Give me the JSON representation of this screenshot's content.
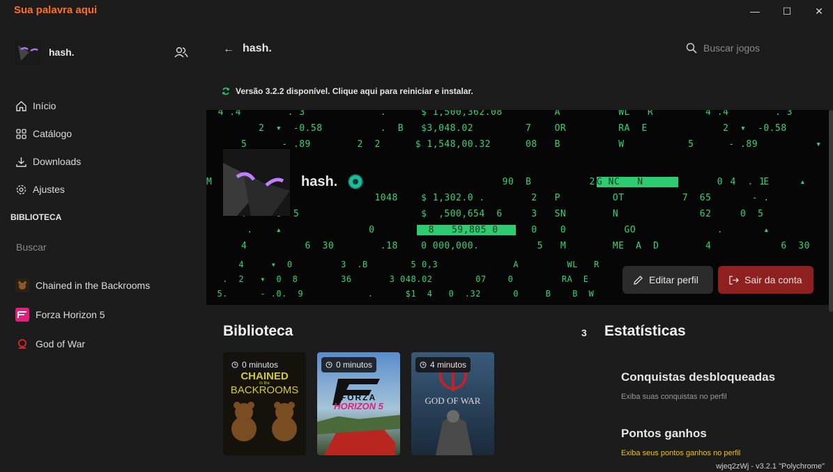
{
  "app": {
    "title": "Sua palavra aqui"
  },
  "window_controls": {
    "minimize": "—",
    "maximize": "☐",
    "close": "✕"
  },
  "sidebar": {
    "profile_name": "hash.",
    "nav": [
      {
        "label": "Início",
        "icon": "home-icon"
      },
      {
        "label": "Catálogo",
        "icon": "grid-icon"
      },
      {
        "label": "Downloads",
        "icon": "download-icon"
      },
      {
        "label": "Ajustes",
        "icon": "gear-icon"
      }
    ],
    "library_heading": "BIBLIOTECA",
    "library_search_placeholder": "Buscar",
    "games": [
      {
        "name": "Chained in the Backrooms",
        "icon": "chained-game-icon"
      },
      {
        "name": "Forza Horizon 5",
        "icon": "forza-game-icon"
      },
      {
        "name": "God of War",
        "icon": "gow-game-icon"
      }
    ]
  },
  "header": {
    "back": "←",
    "title": "hash.",
    "search_placeholder": "Buscar jogos"
  },
  "update_notice": "Versão 3.2.2 disponível. Clique aqui para reiniciar e instalar.",
  "profile_banner": {
    "name": "hash.",
    "matrix_rows": [
      "  4 .4        . 3             .      $ 1,500,362.08         A          WL   R         4 .4        . 3             ",
      "         2  ▾  -0.58          .  B   $3,048.02         7    OR         RA  E             2  ▾  -0.58          .  ",
      "      5      - .89        2  2      $ 1,548,00.32      08   B          W           5      - .89          ▾   ",
      "M                                                                                                         ",
      "     - .                     1048    $ 1,302.0 .        2   P         OT          7  65       - .          ",
      "      .     0  5                     $  ,500,654  6     3   SN        N              62     0  5          ",
      "       .    ▴               0                           0    0          GO              .       ▴          ",
      "      4          6  30        .18    0 000,000.          5   M        ME  A  D        4            6  30    ",
      "      4     ▾  0         3  .B        5 0,3              A         WL   R                                   ",
      "   .  2   ▾  0  8        36       3 048.02        07    0         RA  E                                    ",
      "  5.      - .0.  9            .      $1  4   0  .32      0     B    B  W                                   "
    ],
    "highlight_1": "G NC   N      ",
    "highlight_2": "  8   59,805 0   ",
    "row3_mid": "                                                   90  B          2 0     5    2        0       E ",
    "row3_tail": "         4  . 1      ▴      7 0       ▾"
  },
  "buttons": {
    "edit_profile": "Editar perfil",
    "logout": "Sair da conta"
  },
  "library": {
    "title": "Biblioteca",
    "count": "3",
    "cards": [
      {
        "time": "0 minutos",
        "game": "Chained in the Backrooms",
        "cover_line1": "CHAINED",
        "cover_line2": "in the",
        "cover_line3": "BACKROOMS"
      },
      {
        "time": "0 minutos",
        "game": "Forza Horizon 5",
        "cover_line1": "FORZA",
        "cover_line2": "HORIZON 5"
      },
      {
        "time": "4 minutos",
        "game": "God of War",
        "cover_line1": "GOD OF WAR"
      }
    ]
  },
  "stats": {
    "title": "Estatísticas",
    "achievements_title": "Conquistas desbloqueadas",
    "achievements_desc": "Exiba suas conquistas no perfil",
    "points_title": "Pontos ganhos",
    "points_desc": "Exiba seus pontos ganhos no perfil"
  },
  "footer": {
    "version": "wjeq2zWj - v3.2.1 \"Polychrome\""
  },
  "colors": {
    "accent": "#ff6f1e",
    "matrix_green": "#2fd67a",
    "logout_red": "#8f2020",
    "gold": "#f1c40f"
  }
}
